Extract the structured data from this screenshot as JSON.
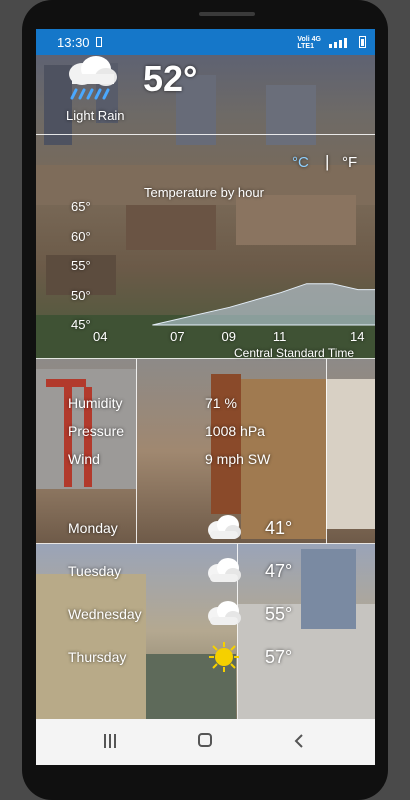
{
  "status": {
    "time": "13:30",
    "network_top": "Voli",
    "network_bottom": "LTE1",
    "network_gen": "4G"
  },
  "current": {
    "condition": "Light Rain",
    "temperature": "52°",
    "unit_c": "°C",
    "unit_sep": "|",
    "unit_f": "°F",
    "condition_icon": "cloud-rain-icon"
  },
  "chart_data": {
    "type": "area",
    "title": "Temperature by hour",
    "x_ticks": [
      "04",
      "07",
      "09",
      "11",
      "14"
    ],
    "y_ticks": [
      "65°",
      "60°",
      "55°",
      "50°",
      "45°"
    ],
    "ylim": [
      45,
      65
    ],
    "x": [
      6,
      9,
      11,
      12,
      13,
      14,
      15
    ],
    "y": [
      45,
      48,
      50.5,
      52,
      52,
      51,
      51
    ],
    "fill_color": "#c8dcf0",
    "timezone": "Central Standard Time"
  },
  "details": [
    {
      "label": "Humidity",
      "value": "71 %"
    },
    {
      "label": "Pressure",
      "value": "1008 hPa"
    },
    {
      "label": "Wind",
      "value": "9 mph SW"
    }
  ],
  "forecast": [
    {
      "day": "Monday",
      "icon": "cloud-icon",
      "temp": "41°"
    },
    {
      "day": "Tuesday",
      "icon": "cloud-icon",
      "temp": "47°"
    },
    {
      "day": "Wednesday",
      "icon": "cloud-icon",
      "temp": "55°"
    },
    {
      "day": "Thursday",
      "icon": "sun-icon",
      "temp": "57°"
    }
  ],
  "colors": {
    "status_bar": "#1577c9",
    "unit_selected": "#8fd0ff",
    "sun": "#f5d000"
  }
}
